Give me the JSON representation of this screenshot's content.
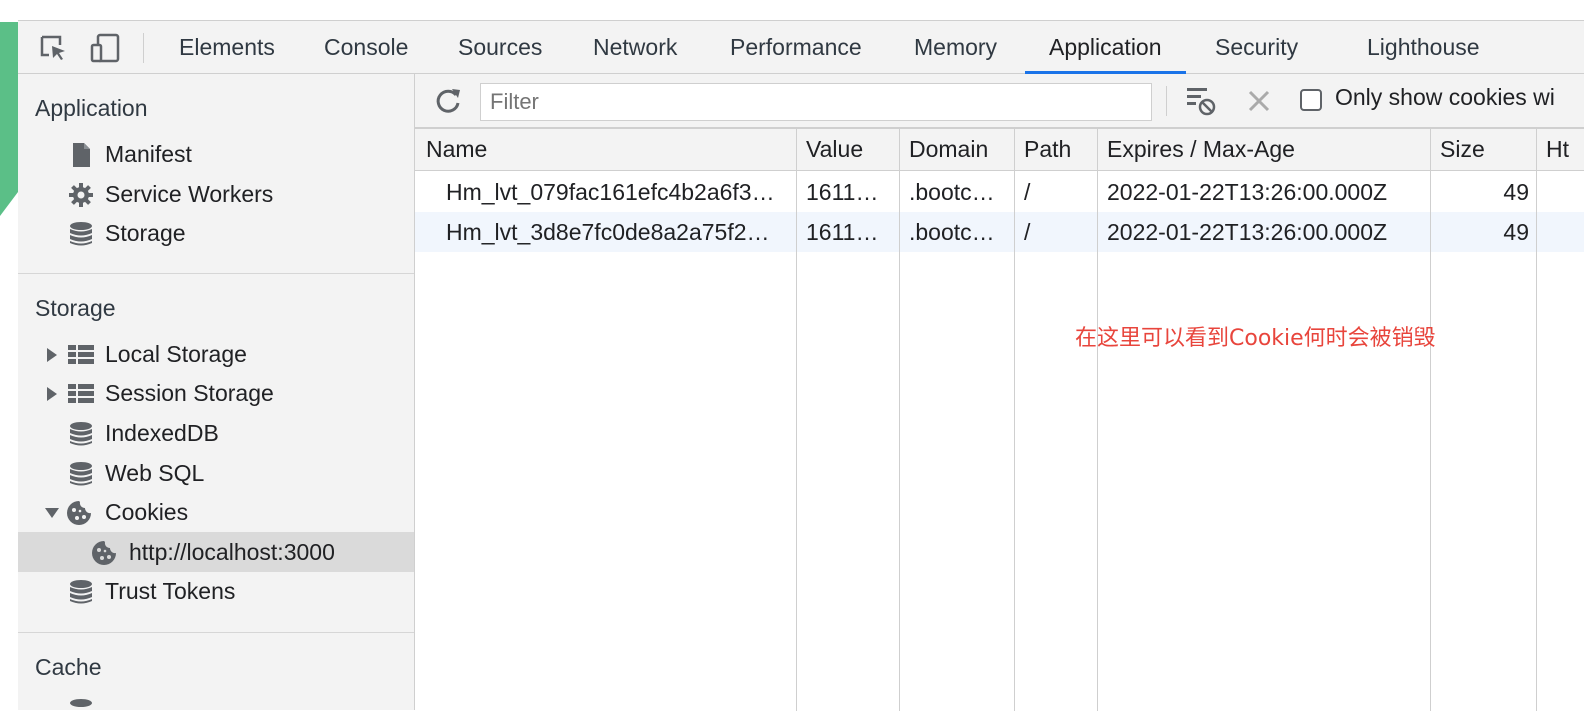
{
  "tabs": [
    {
      "label": "Elements"
    },
    {
      "label": "Console"
    },
    {
      "label": "Sources"
    },
    {
      "label": "Network"
    },
    {
      "label": "Performance"
    },
    {
      "label": "Memory"
    },
    {
      "label": "Application",
      "active": true
    },
    {
      "label": "Security"
    },
    {
      "label": "Lighthouse"
    }
  ],
  "sidebar": {
    "sections": {
      "application": {
        "title": "Application",
        "items": [
          {
            "label": "Manifest",
            "icon": "file-icon"
          },
          {
            "label": "Service Workers",
            "icon": "gear-icon"
          },
          {
            "label": "Storage",
            "icon": "database-icon"
          }
        ]
      },
      "storage": {
        "title": "Storage",
        "items": [
          {
            "label": "Local Storage",
            "icon": "table-icon",
            "expandable": true,
            "expanded": false
          },
          {
            "label": "Session Storage",
            "icon": "table-icon",
            "expandable": true,
            "expanded": false
          },
          {
            "label": "IndexedDB",
            "icon": "database-icon"
          },
          {
            "label": "Web SQL",
            "icon": "database-icon"
          },
          {
            "label": "Cookies",
            "icon": "cookie-icon",
            "expandable": true,
            "expanded": true
          },
          {
            "label": "http://localhost:3000",
            "icon": "cookie-icon",
            "selected": true
          },
          {
            "label": "Trust Tokens",
            "icon": "database-icon"
          }
        ]
      },
      "cache": {
        "title": "Cache"
      }
    }
  },
  "toolbar": {
    "filter_placeholder": "Filter",
    "only_show_label": "Only show cookies wi"
  },
  "table": {
    "columns": [
      "Name",
      "Value",
      "Domain",
      "Path",
      "Expires / Max-Age",
      "Size",
      "Ht"
    ],
    "rows": [
      [
        "Hm_lvt_079fac161efc4b2a6f3…",
        "1611…",
        ".bootc…",
        "/",
        "2022-01-22T13:26:00.000Z",
        "49"
      ],
      [
        "Hm_lvt_3d8e7fc0de8a2a75f2…",
        "1611…",
        ".bootc…",
        "/",
        "2022-01-22T13:26:00.000Z",
        "49"
      ]
    ]
  },
  "annotation": "在这里可以看到Cookie何时会被销毁",
  "colors": {
    "accent": "#1a73e8",
    "annotation": "#e8453c",
    "green_edge": "#5bbf87"
  }
}
